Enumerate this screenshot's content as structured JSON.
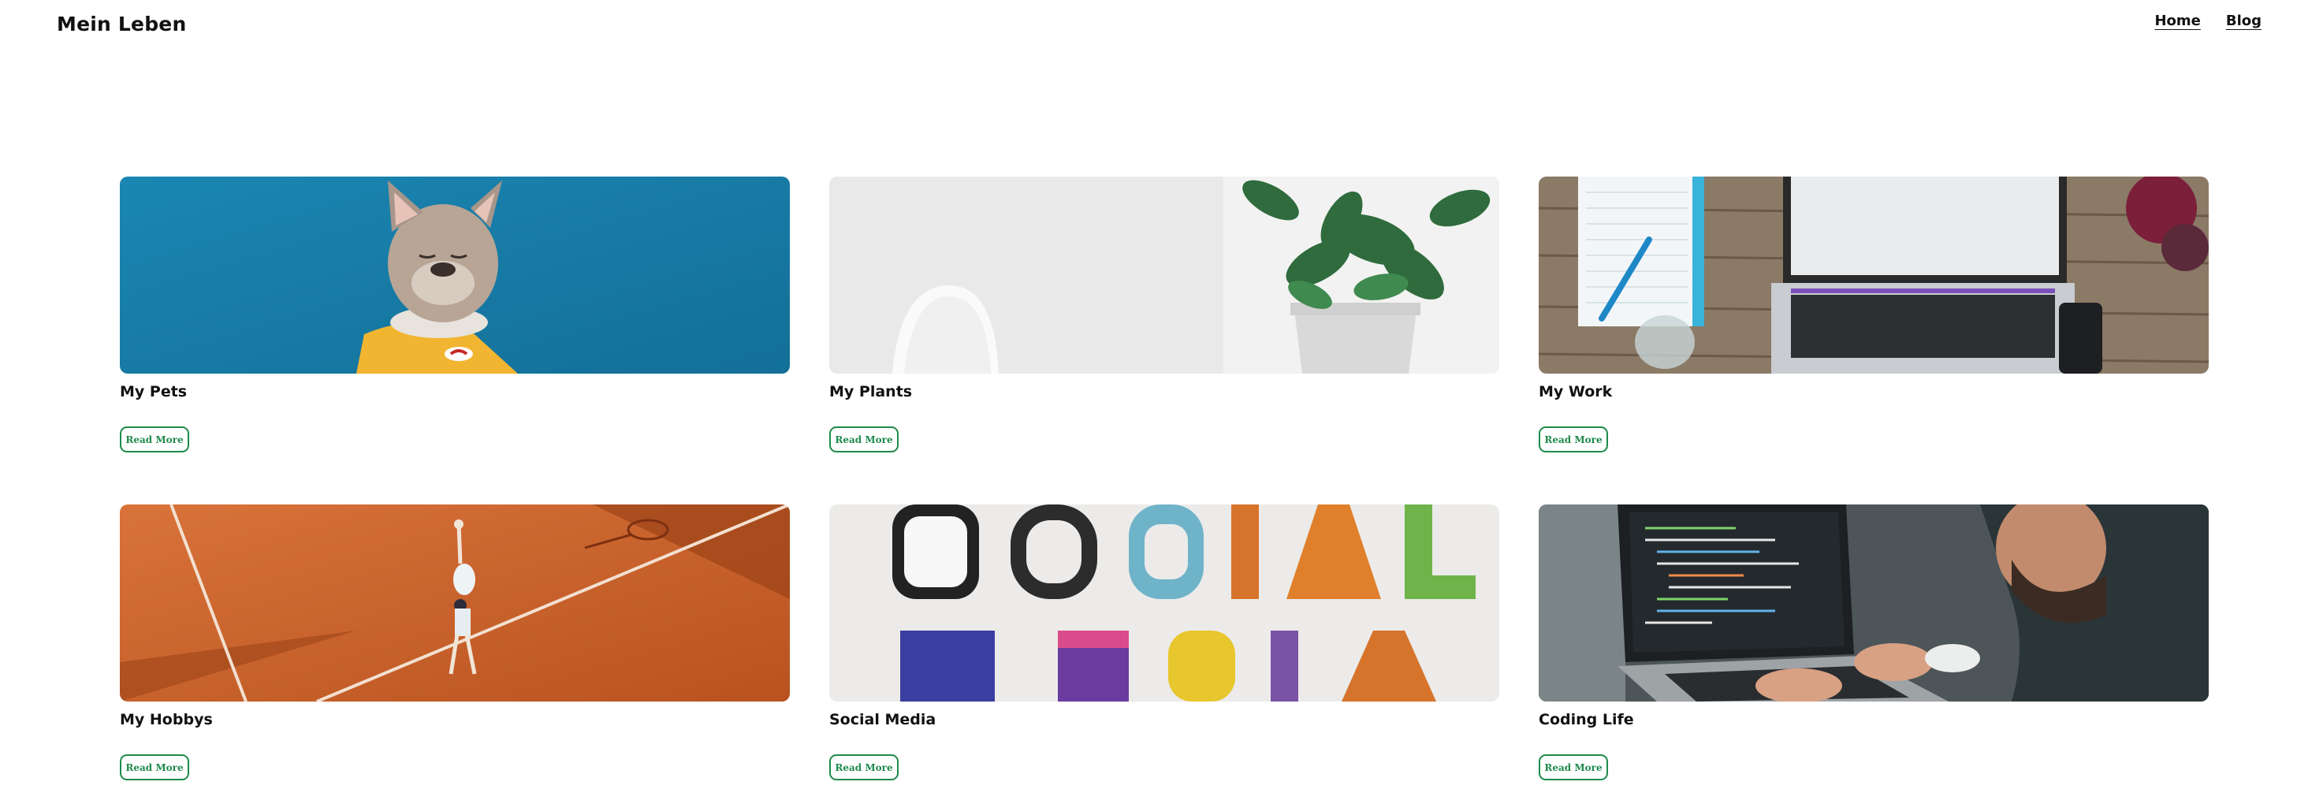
{
  "header": {
    "brand": "Mein Leben",
    "nav": [
      {
        "label": "Home"
      },
      {
        "label": "Blog"
      }
    ]
  },
  "cards": [
    {
      "title": "My Pets",
      "button": "Read More",
      "image": "french-bulldog-yellow-shirt-photo"
    },
    {
      "title": "My Plants",
      "button": "Read More",
      "image": "potted-plant-white-chair-photo"
    },
    {
      "title": "My Work",
      "button": "Read More",
      "image": "laptop-notebook-desk-photo"
    },
    {
      "title": "My Hobbys",
      "button": "Read More",
      "image": "tennis-player-clay-court-photo"
    },
    {
      "title": "Social Media",
      "button": "Read More",
      "image": "social-media-letters-photo"
    },
    {
      "title": "Coding Life",
      "button": "Read More",
      "image": "person-coding-laptop-photo"
    }
  ],
  "colors": {
    "accent": "#1f8a4c",
    "text": "#111111",
    "background": "#ffffff"
  }
}
